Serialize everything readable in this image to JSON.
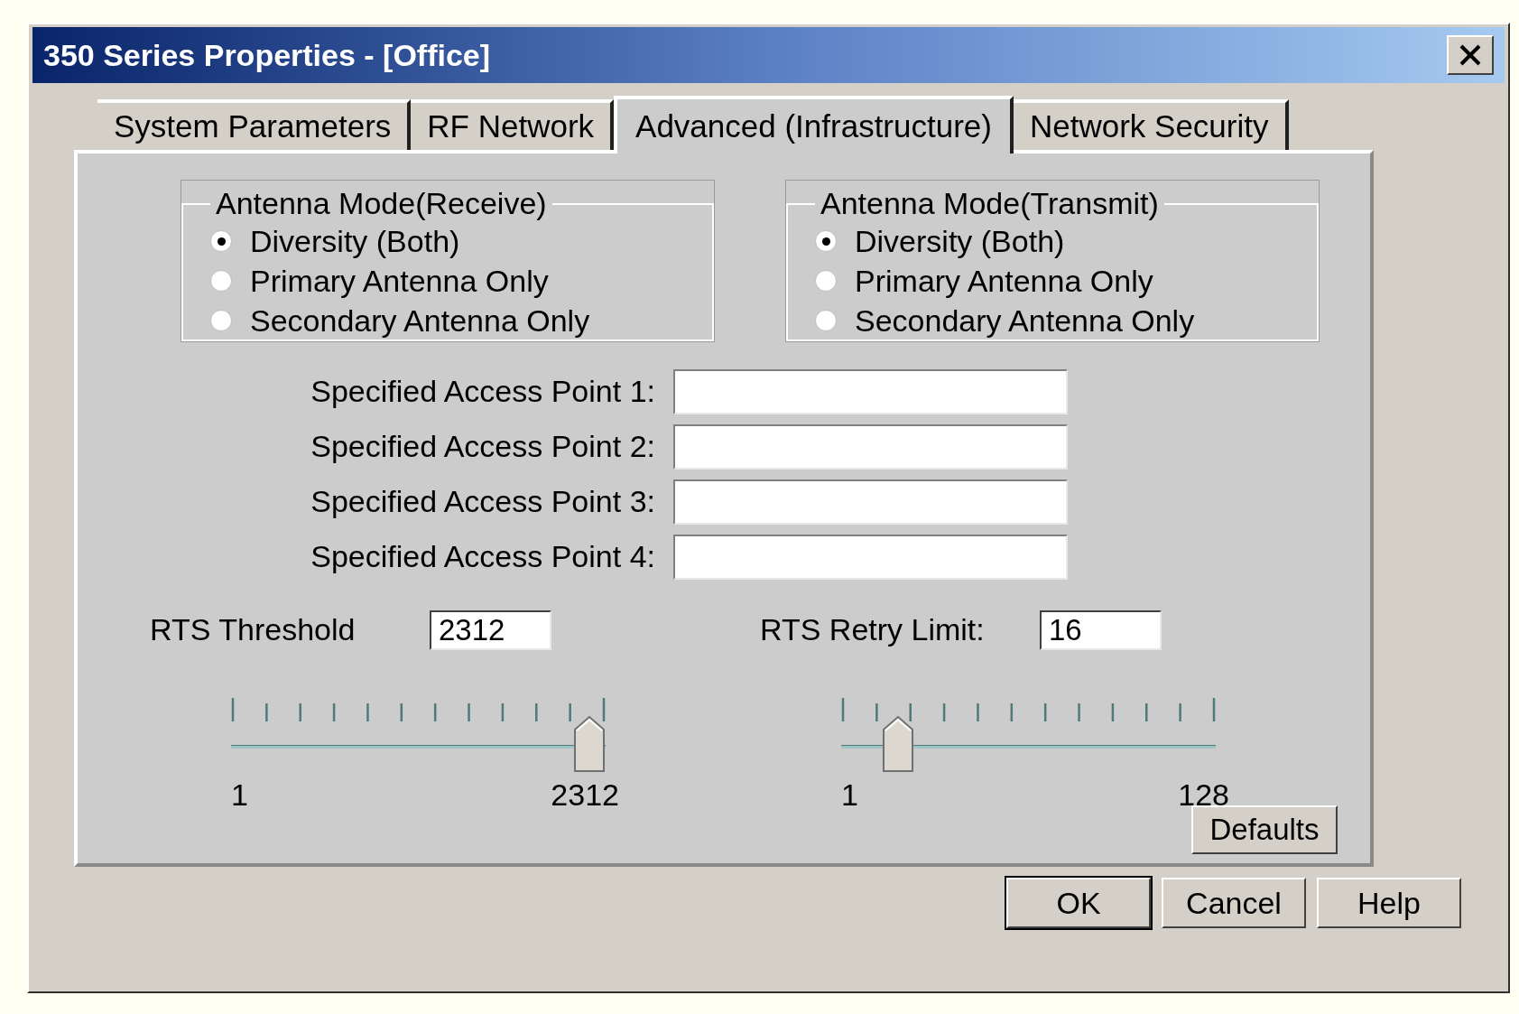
{
  "window": {
    "title": "350 Series Properties - [Office]"
  },
  "tabs": [
    {
      "label": "System Parameters",
      "selected": false
    },
    {
      "label": "RF Network",
      "selected": false
    },
    {
      "label": "Advanced (Infrastructure)",
      "selected": true
    },
    {
      "label": "Network Security",
      "selected": false
    }
  ],
  "antenna_groups": [
    {
      "title": "Antenna Mode(Receive)",
      "options": [
        {
          "label": "Diversity (Both)",
          "selected": true
        },
        {
          "label": "Primary Antenna Only",
          "selected": false
        },
        {
          "label": "Secondary Antenna Only",
          "selected": false
        }
      ]
    },
    {
      "title": "Antenna Mode(Transmit)",
      "options": [
        {
          "label": "Diversity (Both)",
          "selected": true
        },
        {
          "label": "Primary Antenna Only",
          "selected": false
        },
        {
          "label": "Secondary Antenna Only",
          "selected": false
        }
      ]
    }
  ],
  "access_points": [
    {
      "label": "Specified Access Point 1:"
    },
    {
      "label": "Specified Access Point 2:"
    },
    {
      "label": "Specified Access Point 3:"
    },
    {
      "label": "Specified Access Point 4:"
    }
  ],
  "rts": [
    {
      "label": "RTS Threshold",
      "value": "2312",
      "min": "1",
      "max": "2312",
      "level": 1
    },
    {
      "label": "RTS Retry Limit:",
      "value": "16",
      "min": "1",
      "max": "128",
      "level": 0.12
    }
  ],
  "defaults_button": "Defaults",
  "buttons": [
    "OK",
    "Cancel",
    "Help"
  ]
}
